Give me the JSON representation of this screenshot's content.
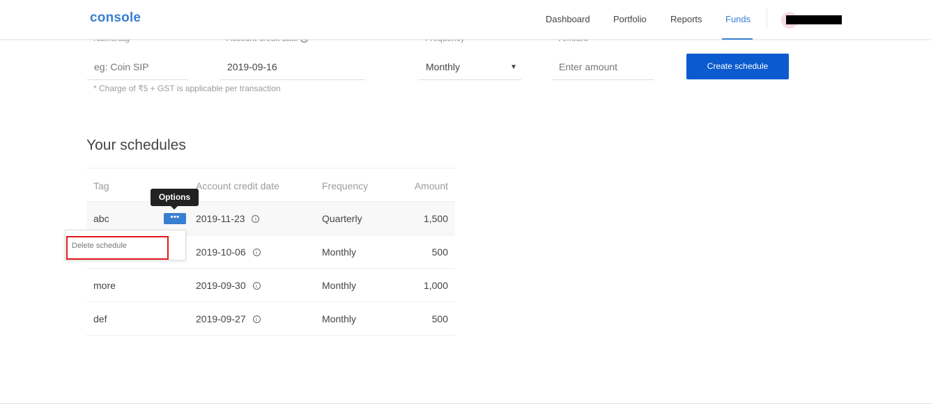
{
  "header": {
    "logo": "console",
    "nav": [
      {
        "label": "Dashboard"
      },
      {
        "label": "Portfolio"
      },
      {
        "label": "Reports"
      },
      {
        "label": "Funds",
        "active": true
      }
    ]
  },
  "form": {
    "tag_label": "Name/tag",
    "tag_placeholder": "eg: Coin SIP",
    "date_label": "Account credit date",
    "date_value": "2019-09-16",
    "frequency_label": "Frequency",
    "frequency_value": "Monthly",
    "amount_label": "Amount",
    "amount_placeholder": "Enter amount",
    "create_button": "Create schedule",
    "charge_note": "* Charge of ₹5 + GST is applicable per transaction"
  },
  "schedules": {
    "title": "Your schedules",
    "columns": [
      "Tag",
      "Account credit date",
      "Frequency",
      "Amount"
    ],
    "rows": [
      {
        "tag": "abc",
        "date": "2019-11-23",
        "frequency": "Quarterly",
        "amount": "1,500"
      },
      {
        "tag": "",
        "date": "2019-10-06",
        "frequency": "Monthly",
        "amount": "500"
      },
      {
        "tag": "more",
        "date": "2019-09-30",
        "frequency": "Monthly",
        "amount": "1,000"
      },
      {
        "tag": "def",
        "date": "2019-09-27",
        "frequency": "Monthly",
        "amount": "500"
      }
    ],
    "options_button": "•••",
    "options_tooltip": "Options",
    "dropdown_item": "Delete schedule"
  },
  "colors": {
    "accent": "#387ed1",
    "button_blue": "#0b5bce",
    "highlight_red": "#e0191c"
  },
  "icons": {
    "info": "info-circle-icon",
    "select_caret": "caret-down-icon",
    "options": "ellipsis-icon"
  }
}
